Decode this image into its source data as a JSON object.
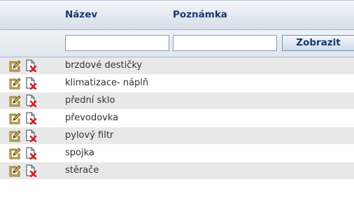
{
  "header": {
    "col_name": "Název",
    "col_note": "Poznámka"
  },
  "filter": {
    "name_value": "",
    "note_value": "",
    "submit_label": "Zobrazit"
  },
  "rows": [
    {
      "name": "brzdové destičky"
    },
    {
      "name": "klimatizace- náplň"
    },
    {
      "name": "přední sklo"
    },
    {
      "name": "převodovka"
    },
    {
      "name": "pylový filtr"
    },
    {
      "name": "spojka"
    },
    {
      "name": "stěrače"
    }
  ],
  "icons": {
    "edit": "edit-icon",
    "delete": "delete-document-icon"
  },
  "colors": {
    "header_text": "#17396b",
    "row_alt": "#e8e8e8",
    "delete_mark": "#d42020",
    "edit_pencil": "#e7b43b"
  }
}
